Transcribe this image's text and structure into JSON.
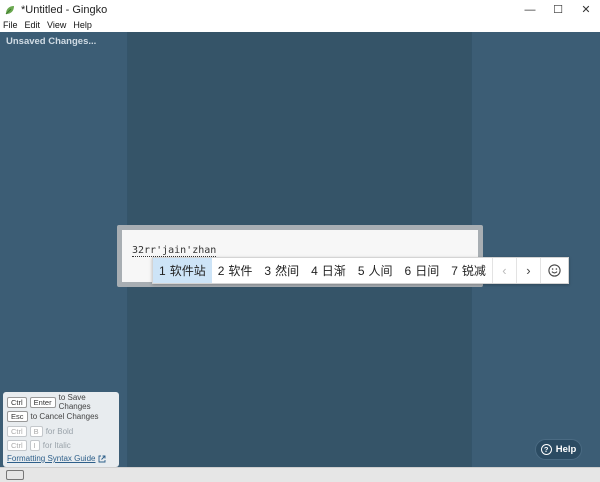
{
  "window": {
    "title": "*Untitled - Gingko",
    "controls": {
      "minimize": "—",
      "maximize": "☐",
      "close": "✕"
    }
  },
  "menu": [
    "File",
    "Edit",
    "View",
    "Help"
  ],
  "status": {
    "unsaved": "Unsaved Changes..."
  },
  "card": {
    "text": "32rr'jain'zhan"
  },
  "ime": {
    "candidates": [
      {
        "num": "1",
        "text": "软件站"
      },
      {
        "num": "2",
        "text": "软件"
      },
      {
        "num": "3",
        "text": "然间"
      },
      {
        "num": "4",
        "text": "日渐"
      },
      {
        "num": "5",
        "text": "人间"
      },
      {
        "num": "6",
        "text": "日间"
      },
      {
        "num": "7",
        "text": "锐减"
      }
    ],
    "prev": "‹",
    "next": "›",
    "selected_index": 0
  },
  "shortcuts": {
    "rows": [
      {
        "keys": [
          "Ctrl",
          "Enter"
        ],
        "desc": "to Save Changes",
        "dim": false
      },
      {
        "keys": [
          "Esc"
        ],
        "desc": "to Cancel Changes",
        "dim": false
      },
      {
        "keys": [
          "Ctrl",
          "B"
        ],
        "desc": "for Bold",
        "dim": true
      },
      {
        "keys": [
          "Ctrl",
          "I"
        ],
        "desc": "for Italic",
        "dim": true
      }
    ],
    "guide_link": "Formatting Syntax Guide"
  },
  "help": {
    "label": "Help",
    "icon": "?"
  },
  "colors": {
    "background": "#3a5a72",
    "center_column": "#355468",
    "selected_candidate": "#cde4f7"
  }
}
